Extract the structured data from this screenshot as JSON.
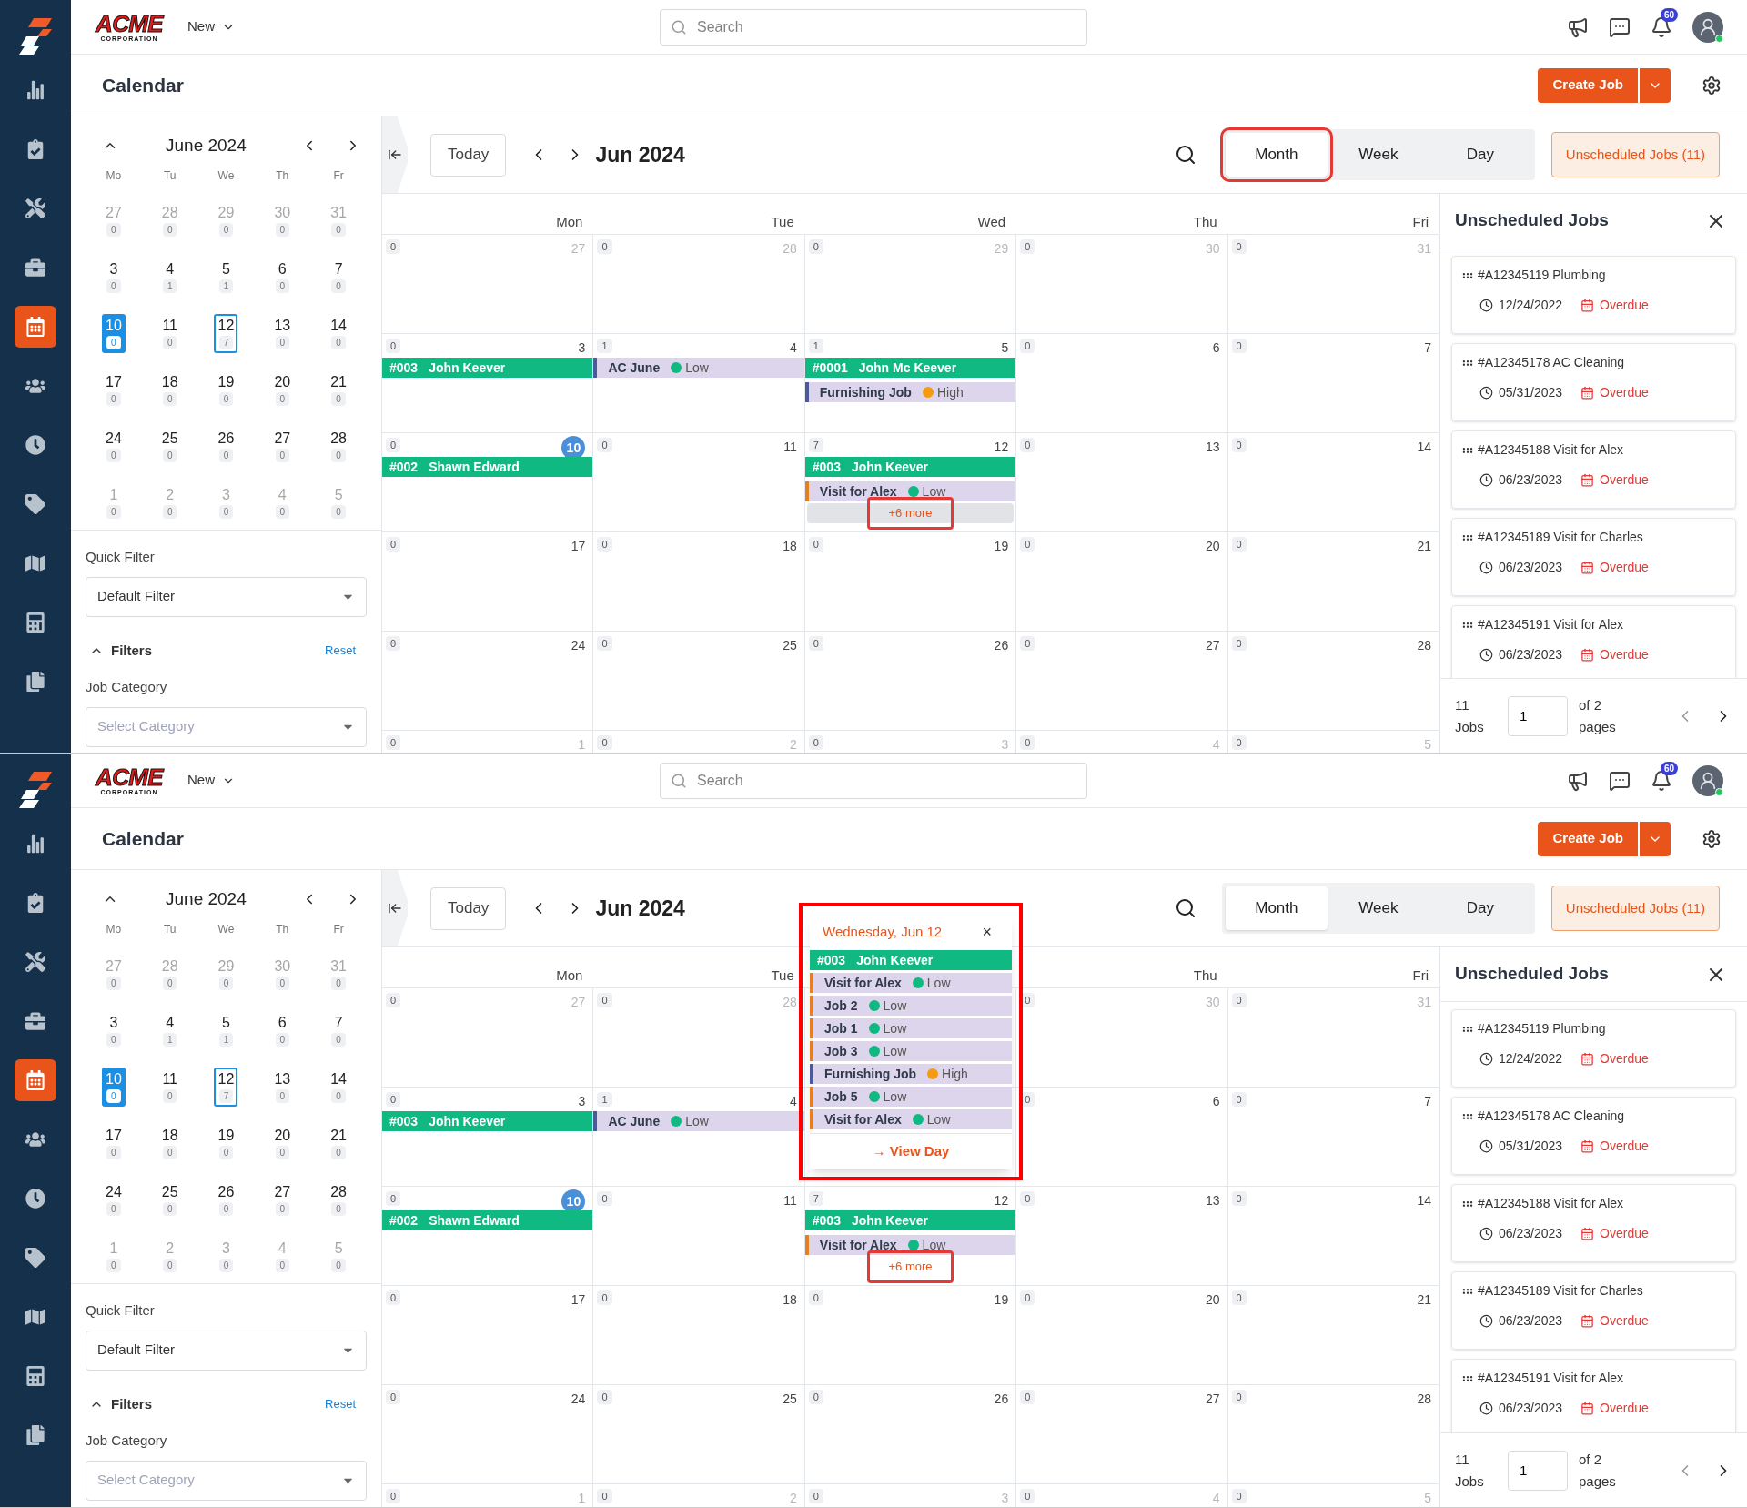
{
  "screens": [
    {
      "sidebar": {
        "items": [
          {
            "selected": false
          },
          {
            "selected": false
          },
          {
            "selected": false
          },
          {
            "selected": false
          },
          {
            "selected": true
          },
          {
            "selected": false
          },
          {
            "selected": false
          },
          {
            "selected": false
          },
          {
            "selected": false
          },
          {
            "selected": false
          },
          {
            "selected": false
          }
        ]
      },
      "topbar": {
        "logo": {
          "name": "ACME",
          "tagline": "CORPORATION"
        },
        "new_menu": "New",
        "search": {
          "placeholder": "Search"
        },
        "notifications": "60",
        "user_online": true
      },
      "header": {
        "title": "Calendar",
        "create_button": "Create Job"
      },
      "mini_calendar": {
        "title": "June 2024",
        "weekdays": [
          "Mo",
          "Tu",
          "We",
          "Th",
          "Fr"
        ],
        "weeks": [
          [
            {
              "day": "27",
              "count": "0",
              "muted": true,
              "today": false,
              "selected": false
            },
            {
              "day": "28",
              "count": "0",
              "muted": true,
              "today": false,
              "selected": false
            },
            {
              "day": "29",
              "count": "0",
              "muted": true,
              "today": false,
              "selected": false
            },
            {
              "day": "30",
              "count": "0",
              "muted": true,
              "today": false,
              "selected": false
            },
            {
              "day": "31",
              "count": "0",
              "muted": true,
              "today": false,
              "selected": false
            }
          ],
          [
            {
              "day": "3",
              "count": "0",
              "muted": false,
              "today": false,
              "selected": false
            },
            {
              "day": "4",
              "count": "1",
              "muted": false,
              "today": false,
              "selected": false
            },
            {
              "day": "5",
              "count": "1",
              "muted": false,
              "today": false,
              "selected": false
            },
            {
              "day": "6",
              "count": "0",
              "muted": false,
              "today": false,
              "selected": false
            },
            {
              "day": "7",
              "count": "0",
              "muted": false,
              "today": false,
              "selected": false
            }
          ],
          [
            {
              "day": "10",
              "count": "0",
              "muted": false,
              "today": true,
              "selected": false
            },
            {
              "day": "11",
              "count": "0",
              "muted": false,
              "today": false,
              "selected": false
            },
            {
              "day": "12",
              "count": "7",
              "muted": false,
              "today": false,
              "selected": true
            },
            {
              "day": "13",
              "count": "0",
              "muted": false,
              "today": false,
              "selected": false
            },
            {
              "day": "14",
              "count": "0",
              "muted": false,
              "today": false,
              "selected": false
            }
          ],
          [
            {
              "day": "17",
              "count": "0",
              "muted": false,
              "today": false,
              "selected": false
            },
            {
              "day": "18",
              "count": "0",
              "muted": false,
              "today": false,
              "selected": false
            },
            {
              "day": "19",
              "count": "0",
              "muted": false,
              "today": false,
              "selected": false
            },
            {
              "day": "20",
              "count": "0",
              "muted": false,
              "today": false,
              "selected": false
            },
            {
              "day": "21",
              "count": "0",
              "muted": false,
              "today": false,
              "selected": false
            }
          ],
          [
            {
              "day": "24",
              "count": "0",
              "muted": false,
              "today": false,
              "selected": false
            },
            {
              "day": "25",
              "count": "0",
              "muted": false,
              "today": false,
              "selected": false
            },
            {
              "day": "26",
              "count": "0",
              "muted": false,
              "today": false,
              "selected": false
            },
            {
              "day": "27",
              "count": "0",
              "muted": false,
              "today": false,
              "selected": false
            },
            {
              "day": "28",
              "count": "0",
              "muted": false,
              "today": false,
              "selected": false
            }
          ],
          [
            {
              "day": "1",
              "count": "0",
              "muted": true,
              "today": false,
              "selected": false
            },
            {
              "day": "2",
              "count": "0",
              "muted": true,
              "today": false,
              "selected": false
            },
            {
              "day": "3",
              "count": "0",
              "muted": true,
              "today": false,
              "selected": false
            },
            {
              "day": "4",
              "count": "0",
              "muted": true,
              "today": false,
              "selected": false
            },
            {
              "day": "5",
              "count": "0",
              "muted": true,
              "today": false,
              "selected": false
            }
          ]
        ]
      },
      "quick_filter": {
        "label": "Quick Filter",
        "value": "Default Filter"
      },
      "filters": {
        "title": "Filters",
        "expanded": true,
        "reset": "Reset",
        "category_label": "Job Category",
        "category_placeholder": "Select Category"
      },
      "toolbar": {
        "today": "Today",
        "title": "Jun 2024",
        "views": [
          {
            "label": "Month",
            "selected": true,
            "highlighted": true
          },
          {
            "label": "Week",
            "selected": false,
            "highlighted": false
          },
          {
            "label": "Day",
            "selected": false,
            "highlighted": false
          }
        ],
        "unscheduled_button": "Unscheduled Jobs (11)"
      },
      "grid": {
        "weekdays": [
          {
            "label": "Mon"
          },
          {
            "label": "Tue"
          },
          {
            "label": "Wed"
          },
          {
            "label": "Thu"
          },
          {
            "label": "Fri"
          }
        ],
        "weeks": [
          [
            {
              "date": "27",
              "count": "0",
              "muted": true,
              "today": false
            },
            {
              "date": "28",
              "count": "0",
              "muted": true,
              "today": false
            },
            {
              "date": "29",
              "count": "0",
              "muted": true,
              "today": false
            },
            {
              "date": "30",
              "count": "0",
              "muted": true,
              "today": false
            },
            {
              "date": "31",
              "count": "0",
              "muted": true,
              "today": false
            }
          ],
          [
            {
              "date": "3",
              "count": "0",
              "muted": false,
              "today": false,
              "events": [
                {
                  "kind": "job",
                  "number": "#003",
                  "name": "John Keever"
                }
              ]
            },
            {
              "date": "4",
              "count": "1",
              "muted": false,
              "today": false,
              "events": [
                {
                  "kind": "task",
                  "title": "AC June",
                  "color": "#4a5a9c",
                  "priority": {
                    "label": "Low",
                    "color": "#10b981"
                  }
                }
              ]
            },
            {
              "date": "5",
              "count": "1",
              "muted": false,
              "today": false,
              "events": [
                {
                  "kind": "job",
                  "number": "#0001",
                  "name": "John Mc Keever"
                },
                {
                  "kind": "task",
                  "title": "Furnishing Job",
                  "color": "#4a5a9c",
                  "priority": {
                    "label": "High",
                    "color": "#f39c12"
                  }
                }
              ]
            },
            {
              "date": "6",
              "count": "0",
              "muted": false,
              "today": false
            },
            {
              "date": "7",
              "count": "0",
              "muted": false,
              "today": false
            }
          ],
          [
            {
              "date": "10",
              "count": "0",
              "muted": false,
              "today": true,
              "events": [
                {
                  "kind": "job",
                  "number": "#002",
                  "name": "Shawn Edward"
                }
              ]
            },
            {
              "date": "11",
              "count": "0",
              "muted": false,
              "today": false
            },
            {
              "date": "12",
              "count": "7",
              "muted": false,
              "today": false,
              "events": [
                {
                  "kind": "job",
                  "number": "#003",
                  "name": "John Keever"
                },
                {
                  "kind": "task",
                  "title": "Visit for Alex",
                  "color": "#e67e22",
                  "priority": {
                    "label": "Low",
                    "color": "#10b981"
                  }
                }
              ],
              "more": {
                "label": "+6 more",
                "hovered": true,
                "highlighted": true
              }
            },
            {
              "date": "13",
              "count": "0",
              "muted": false,
              "today": false
            },
            {
              "date": "14",
              "count": "0",
              "muted": false,
              "today": false
            }
          ],
          [
            {
              "date": "17",
              "count": "0",
              "muted": false,
              "today": false
            },
            {
              "date": "18",
              "count": "0",
              "muted": false,
              "today": false
            },
            {
              "date": "19",
              "count": "0",
              "muted": false,
              "today": false
            },
            {
              "date": "20",
              "count": "0",
              "muted": false,
              "today": false
            },
            {
              "date": "21",
              "count": "0",
              "muted": false,
              "today": false
            }
          ],
          [
            {
              "date": "24",
              "count": "0",
              "muted": false,
              "today": false
            },
            {
              "date": "25",
              "count": "0",
              "muted": false,
              "today": false
            },
            {
              "date": "26",
              "count": "0",
              "muted": false,
              "today": false
            },
            {
              "date": "27",
              "count": "0",
              "muted": false,
              "today": false
            },
            {
              "date": "28",
              "count": "0",
              "muted": false,
              "today": false
            }
          ],
          [
            {
              "date": "1",
              "count": "0",
              "muted": true,
              "today": false
            },
            {
              "date": "2",
              "count": "0",
              "muted": true,
              "today": false
            },
            {
              "date": "3",
              "count": "0",
              "muted": true,
              "today": false
            },
            {
              "date": "4",
              "count": "0",
              "muted": true,
              "today": false
            },
            {
              "date": "5",
              "count": "0",
              "muted": true,
              "today": false
            }
          ]
        ]
      },
      "unscheduled": {
        "title": "Unscheduled Jobs",
        "jobs": [
          {
            "title": "#A12345119 Plumbing",
            "date": "12/24/2022",
            "status": "Overdue"
          },
          {
            "title": "#A12345178 AC Cleaning",
            "date": "05/31/2023",
            "status": "Overdue"
          },
          {
            "title": "#A12345188 Visit for Alex",
            "date": "06/23/2023",
            "status": "Overdue"
          },
          {
            "title": "#A12345189 Visit for Charles",
            "date": "06/23/2023",
            "status": "Overdue"
          },
          {
            "title": "#A12345191 Visit for Alex",
            "date": "06/23/2023",
            "status": "Overdue"
          }
        ],
        "total": "11 Jobs",
        "page": "1",
        "of_pages": "of 2 pages"
      }
    },
    {
      "sidebar": {
        "items": [
          {
            "selected": false
          },
          {
            "selected": false
          },
          {
            "selected": false
          },
          {
            "selected": false
          },
          {
            "selected": true
          },
          {
            "selected": false
          },
          {
            "selected": false
          },
          {
            "selected": false
          },
          {
            "selected": false
          },
          {
            "selected": false
          },
          {
            "selected": false
          }
        ]
      },
      "topbar": {
        "logo": {
          "name": "ACME",
          "tagline": "CORPORATION"
        },
        "new_menu": "New",
        "search": {
          "placeholder": "Search"
        },
        "notifications": "60",
        "user_online": true
      },
      "header": {
        "title": "Calendar",
        "create_button": "Create Job"
      },
      "mini_calendar": {
        "title": "June 2024",
        "weekdays": [
          "Mo",
          "Tu",
          "We",
          "Th",
          "Fr"
        ],
        "weeks": [
          [
            {
              "day": "27",
              "count": "0",
              "muted": true,
              "today": false,
              "selected": false
            },
            {
              "day": "28",
              "count": "0",
              "muted": true,
              "today": false,
              "selected": false
            },
            {
              "day": "29",
              "count": "0",
              "muted": true,
              "today": false,
              "selected": false
            },
            {
              "day": "30",
              "count": "0",
              "muted": true,
              "today": false,
              "selected": false
            },
            {
              "day": "31",
              "count": "0",
              "muted": true,
              "today": false,
              "selected": false
            }
          ],
          [
            {
              "day": "3",
              "count": "0",
              "muted": false,
              "today": false,
              "selected": false
            },
            {
              "day": "4",
              "count": "1",
              "muted": false,
              "today": false,
              "selected": false
            },
            {
              "day": "5",
              "count": "1",
              "muted": false,
              "today": false,
              "selected": false
            },
            {
              "day": "6",
              "count": "0",
              "muted": false,
              "today": false,
              "selected": false
            },
            {
              "day": "7",
              "count": "0",
              "muted": false,
              "today": false,
              "selected": false
            }
          ],
          [
            {
              "day": "10",
              "count": "0",
              "muted": false,
              "today": true,
              "selected": false
            },
            {
              "day": "11",
              "count": "0",
              "muted": false,
              "today": false,
              "selected": false
            },
            {
              "day": "12",
              "count": "7",
              "muted": false,
              "today": false,
              "selected": true
            },
            {
              "day": "13",
              "count": "0",
              "muted": false,
              "today": false,
              "selected": false
            },
            {
              "day": "14",
              "count": "0",
              "muted": false,
              "today": false,
              "selected": false
            }
          ],
          [
            {
              "day": "17",
              "count": "0",
              "muted": false,
              "today": false,
              "selected": false
            },
            {
              "day": "18",
              "count": "0",
              "muted": false,
              "today": false,
              "selected": false
            },
            {
              "day": "19",
              "count": "0",
              "muted": false,
              "today": false,
              "selected": false
            },
            {
              "day": "20",
              "count": "0",
              "muted": false,
              "today": false,
              "selected": false
            },
            {
              "day": "21",
              "count": "0",
              "muted": false,
              "today": false,
              "selected": false
            }
          ],
          [
            {
              "day": "24",
              "count": "0",
              "muted": false,
              "today": false,
              "selected": false
            },
            {
              "day": "25",
              "count": "0",
              "muted": false,
              "today": false,
              "selected": false
            },
            {
              "day": "26",
              "count": "0",
              "muted": false,
              "today": false,
              "selected": false
            },
            {
              "day": "27",
              "count": "0",
              "muted": false,
              "today": false,
              "selected": false
            },
            {
              "day": "28",
              "count": "0",
              "muted": false,
              "today": false,
              "selected": false
            }
          ],
          [
            {
              "day": "1",
              "count": "0",
              "muted": true,
              "today": false,
              "selected": false
            },
            {
              "day": "2",
              "count": "0",
              "muted": true,
              "today": false,
              "selected": false
            },
            {
              "day": "3",
              "count": "0",
              "muted": true,
              "today": false,
              "selected": false
            },
            {
              "day": "4",
              "count": "0",
              "muted": true,
              "today": false,
              "selected": false
            },
            {
              "day": "5",
              "count": "0",
              "muted": true,
              "today": false,
              "selected": false
            }
          ]
        ]
      },
      "quick_filter": {
        "label": "Quick Filter",
        "value": "Default Filter"
      },
      "filters": {
        "title": "Filters",
        "expanded": true,
        "reset": "Reset",
        "category_label": "Job Category",
        "category_placeholder": "Select Category"
      },
      "toolbar": {
        "today": "Today",
        "title": "Jun 2024",
        "views": [
          {
            "label": "Month",
            "selected": true,
            "highlighted": false
          },
          {
            "label": "Week",
            "selected": false,
            "highlighted": false
          },
          {
            "label": "Day",
            "selected": false,
            "highlighted": false
          }
        ],
        "unscheduled_button": "Unscheduled Jobs (11)"
      },
      "grid": {
        "weekdays": [
          {
            "label": "Mon"
          },
          {
            "label": "Tue"
          },
          {
            "covered": true
          },
          {
            "label": "Thu"
          },
          {
            "label": "Fri"
          }
        ],
        "weeks": [
          [
            {
              "date": "27",
              "count": "0",
              "muted": true,
              "today": false
            },
            {
              "date": "28",
              "count": "0",
              "muted": true,
              "today": false
            },
            {
              "covered": true
            },
            {
              "date": "30",
              "count": "0",
              "muted": true,
              "today": false
            },
            {
              "date": "31",
              "count": "0",
              "muted": true,
              "today": false
            }
          ],
          [
            {
              "date": "3",
              "count": "0",
              "muted": false,
              "today": false,
              "events": [
                {
                  "kind": "job",
                  "number": "#003",
                  "name": "John Keever"
                }
              ]
            },
            {
              "date": "4",
              "count": "1",
              "muted": false,
              "today": false,
              "events": [
                {
                  "kind": "task",
                  "title": "AC June",
                  "color": "#4a5a9c",
                  "priority": {
                    "label": "Low",
                    "color": "#10b981"
                  }
                }
              ]
            },
            {
              "covered": true
            },
            {
              "date": "6",
              "count": "0",
              "muted": false,
              "today": false
            },
            {
              "date": "7",
              "count": "0",
              "muted": false,
              "today": false
            }
          ],
          [
            {
              "date": "10",
              "count": "0",
              "muted": false,
              "today": true,
              "events": [
                {
                  "kind": "job",
                  "number": "#002",
                  "name": "Shawn Edward"
                }
              ]
            },
            {
              "date": "11",
              "count": "0",
              "muted": false,
              "today": false
            },
            {
              "date": "12",
              "count": "7",
              "muted": false,
              "today": false,
              "events": [
                {
                  "kind": "job",
                  "number": "#003",
                  "name": "John Keever"
                },
                {
                  "kind": "task",
                  "title": "Visit for Alex",
                  "color": "#e67e22",
                  "priority": {
                    "label": "Low",
                    "color": "#10b981"
                  }
                }
              ],
              "more": {
                "label": "+6 more",
                "hovered": false,
                "highlighted": true
              }
            },
            {
              "date": "13",
              "count": "0",
              "muted": false,
              "today": false
            },
            {
              "date": "14",
              "count": "0",
              "muted": false,
              "today": false
            }
          ],
          [
            {
              "date": "17",
              "count": "0",
              "muted": false,
              "today": false
            },
            {
              "date": "18",
              "count": "0",
              "muted": false,
              "today": false
            },
            {
              "date": "19",
              "count": "0",
              "muted": false,
              "today": false
            },
            {
              "date": "20",
              "count": "0",
              "muted": false,
              "today": false
            },
            {
              "date": "21",
              "count": "0",
              "muted": false,
              "today": false
            }
          ],
          [
            {
              "date": "24",
              "count": "0",
              "muted": false,
              "today": false
            },
            {
              "date": "25",
              "count": "0",
              "muted": false,
              "today": false
            },
            {
              "date": "26",
              "count": "0",
              "muted": false,
              "today": false
            },
            {
              "date": "27",
              "count": "0",
              "muted": false,
              "today": false
            },
            {
              "date": "28",
              "count": "0",
              "muted": false,
              "today": false
            }
          ],
          [
            {
              "date": "1",
              "count": "0",
              "muted": true,
              "today": false
            },
            {
              "date": "2",
              "count": "0",
              "muted": true,
              "today": false
            },
            {
              "date": "3",
              "count": "0",
              "muted": true,
              "today": false
            },
            {
              "date": "4",
              "count": "0",
              "muted": true,
              "today": false
            },
            {
              "date": "5",
              "count": "0",
              "muted": true,
              "today": false
            }
          ]
        ]
      },
      "popup": {
        "title": "Wednesday, Jun 12",
        "close": "×",
        "highlighted": true,
        "events": [
          {
            "kind": "job",
            "number": "#003",
            "name": "John Keever"
          },
          {
            "kind": "task",
            "title": "Visit for Alex",
            "color": "#e67e22",
            "priority": {
              "label": "Low",
              "color": "#10b981"
            }
          },
          {
            "kind": "task",
            "title": "Job 2",
            "color": "#e67e22",
            "priority": {
              "label": "Low",
              "color": "#10b981"
            }
          },
          {
            "kind": "task",
            "title": "Job 1",
            "color": "#e67e22",
            "priority": {
              "label": "Low",
              "color": "#10b981"
            }
          },
          {
            "kind": "task",
            "title": "Job 3",
            "color": "#e67e22",
            "priority": {
              "label": "Low",
              "color": "#10b981"
            }
          },
          {
            "kind": "task",
            "title": "Furnishing Job",
            "color": "#4a5a9c",
            "priority": {
              "label": "High",
              "color": "#f39c12"
            }
          },
          {
            "kind": "task",
            "title": "Job 5",
            "color": "#e67e22",
            "priority": {
              "label": "Low",
              "color": "#10b981"
            }
          },
          {
            "kind": "task",
            "title": "Visit for Alex",
            "color": "#e67e22",
            "priority": {
              "label": "Low",
              "color": "#10b981"
            }
          }
        ],
        "view_day": "→ View Day"
      },
      "unscheduled": {
        "title": "Unscheduled Jobs",
        "jobs": [
          {
            "title": "#A12345119 Plumbing",
            "date": "12/24/2022",
            "status": "Overdue"
          },
          {
            "title": "#A12345178 AC Cleaning",
            "date": "05/31/2023",
            "status": "Overdue"
          },
          {
            "title": "#A12345188 Visit for Alex",
            "date": "06/23/2023",
            "status": "Overdue"
          },
          {
            "title": "#A12345189 Visit for Charles",
            "date": "06/23/2023",
            "status": "Overdue"
          },
          {
            "title": "#A12345191 Visit for Alex",
            "date": "06/23/2023",
            "status": "Overdue"
          }
        ],
        "total": "11 Jobs",
        "page": "1",
        "of_pages": "of 2 pages"
      }
    }
  ]
}
